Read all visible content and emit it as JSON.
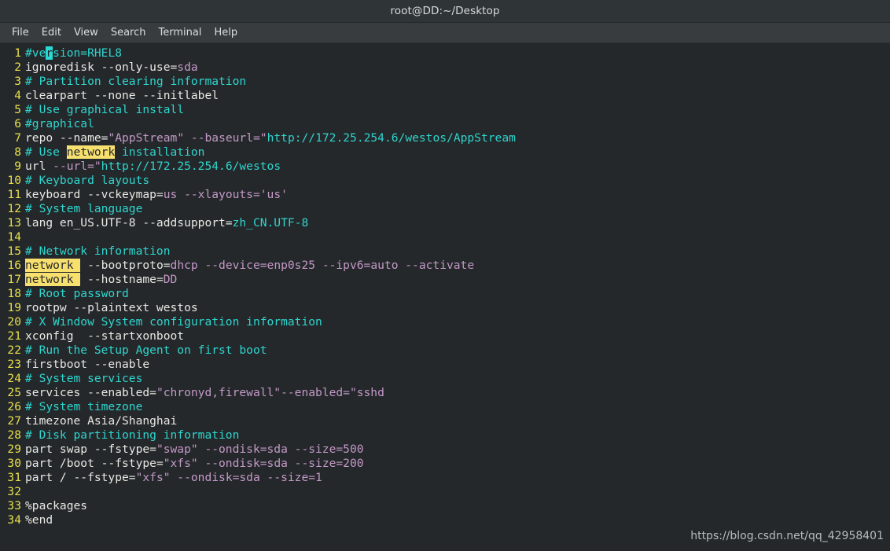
{
  "window": {
    "title": "root@DD:~/Desktop"
  },
  "menubar": {
    "items": [
      {
        "label": "File"
      },
      {
        "label": "Edit"
      },
      {
        "label": "View"
      },
      {
        "label": "Search"
      },
      {
        "label": "Terminal"
      },
      {
        "label": "Help"
      }
    ]
  },
  "editor": {
    "colors": {
      "background": "#24282b",
      "titlebar": "#2f3437",
      "menubar": "#383c3f",
      "foreground": "#e8e8e3",
      "lineno": "#e8e04a",
      "comment": "#2fd5cd",
      "string_mauve": "#c499c6",
      "string_cyan": "#2fd5cd",
      "cursor": "#29d9d5",
      "search_highlight": "#f7e06e"
    },
    "first_line": 1,
    "total_lines": 34,
    "lines": [
      {
        "n": "1",
        "tokens": [
          {
            "t": "#ve",
            "c": "comment"
          },
          {
            "t": "r",
            "c": "cursor"
          },
          {
            "t": "sion=RHEL8",
            "c": "comment"
          }
        ]
      },
      {
        "n": "2",
        "tokens": [
          {
            "t": "ignoredisk --only-use=",
            "c": "plain"
          },
          {
            "t": "sda",
            "c": "mauve"
          }
        ]
      },
      {
        "n": "3",
        "tokens": [
          {
            "t": "# Partition clearing information",
            "c": "comment"
          }
        ]
      },
      {
        "n": "4",
        "tokens": [
          {
            "t": "clearpart --none --initlabel",
            "c": "plain"
          }
        ]
      },
      {
        "n": "5",
        "tokens": [
          {
            "t": "# Use graphical install",
            "c": "comment"
          }
        ]
      },
      {
        "n": "6",
        "tokens": [
          {
            "t": "#graphical",
            "c": "comment"
          }
        ]
      },
      {
        "n": "7",
        "tokens": [
          {
            "t": "repo ",
            "c": "plain"
          },
          {
            "t": "--name=",
            "c": "plain"
          },
          {
            "t": "\"",
            "c": "mauve"
          },
          {
            "t": "AppStream",
            "c": "mauve"
          },
          {
            "t": "\"",
            "c": "mauve"
          },
          {
            "t": " ",
            "c": "plain"
          },
          {
            "t": "--baseurl=",
            "c": "mauve"
          },
          {
            "t": "\"",
            "c": "mauve"
          },
          {
            "t": "http://172.25.254.6/westos/AppStream",
            "c": "cyan"
          }
        ]
      },
      {
        "n": "8",
        "tokens": [
          {
            "t": "# Use ",
            "c": "comment"
          },
          {
            "t": "network",
            "c": "hl"
          },
          {
            "t": " installation",
            "c": "comment"
          }
        ]
      },
      {
        "n": "9",
        "tokens": [
          {
            "t": "url ",
            "c": "plain"
          },
          {
            "t": "--url=",
            "c": "mauve"
          },
          {
            "t": "\"",
            "c": "mauve"
          },
          {
            "t": "http://172.25.254.6/westos",
            "c": "cyan"
          }
        ]
      },
      {
        "n": "10",
        "tokens": [
          {
            "t": "# Keyboard layouts",
            "c": "comment"
          }
        ]
      },
      {
        "n": "11",
        "tokens": [
          {
            "t": "keyboard --vckeymap=",
            "c": "plain"
          },
          {
            "t": "us",
            "c": "mauve"
          },
          {
            "t": " --xlayouts='us'",
            "c": "mauve"
          }
        ]
      },
      {
        "n": "12",
        "tokens": [
          {
            "t": "# System language",
            "c": "comment"
          }
        ]
      },
      {
        "n": "13",
        "tokens": [
          {
            "t": "lang en_US.UTF-8 --addsupport=",
            "c": "plain"
          },
          {
            "t": "zh_CN.UTF-8",
            "c": "cyan"
          }
        ]
      },
      {
        "n": "14",
        "tokens": []
      },
      {
        "n": "15",
        "tokens": [
          {
            "t": "# Network information",
            "c": "comment"
          }
        ]
      },
      {
        "n": "16",
        "tokens": [
          {
            "t": "network ",
            "c": "hl"
          },
          {
            "t": " --bootproto=",
            "c": "plain"
          },
          {
            "t": "dhcp --device=enp0s25 --ipv6=auto --activate",
            "c": "mauve"
          }
        ]
      },
      {
        "n": "17",
        "tokens": [
          {
            "t": "network ",
            "c": "hl"
          },
          {
            "t": " --hostname=",
            "c": "plain"
          },
          {
            "t": "DD",
            "c": "mauve"
          }
        ]
      },
      {
        "n": "18",
        "tokens": [
          {
            "t": "# Root password",
            "c": "comment"
          }
        ]
      },
      {
        "n": "19",
        "tokens": [
          {
            "t": "rootpw --plaintext westos",
            "c": "plain"
          }
        ]
      },
      {
        "n": "20",
        "tokens": [
          {
            "t": "# X Window System configuration information",
            "c": "comment"
          }
        ]
      },
      {
        "n": "21",
        "tokens": [
          {
            "t": "xconfig  --startxonboot",
            "c": "plain"
          }
        ]
      },
      {
        "n": "22",
        "tokens": [
          {
            "t": "# Run the Setup Agent on first boot",
            "c": "comment"
          }
        ]
      },
      {
        "n": "23",
        "tokens": [
          {
            "t": "firstboot --enable",
            "c": "plain"
          }
        ]
      },
      {
        "n": "24",
        "tokens": [
          {
            "t": "# System services",
            "c": "comment"
          }
        ]
      },
      {
        "n": "25",
        "tokens": [
          {
            "t": "services --enabled=",
            "c": "plain"
          },
          {
            "t": "\"chronyd,firewall\"--enabled=\"sshd",
            "c": "mauve"
          }
        ]
      },
      {
        "n": "26",
        "tokens": [
          {
            "t": "# System timezone",
            "c": "comment"
          }
        ]
      },
      {
        "n": "27",
        "tokens": [
          {
            "t": "timezone Asia/Shanghai",
            "c": "plain"
          }
        ]
      },
      {
        "n": "28",
        "tokens": [
          {
            "t": "# Disk partitioning information",
            "c": "comment"
          }
        ]
      },
      {
        "n": "29",
        "tokens": [
          {
            "t": "part swap --fstype=",
            "c": "plain"
          },
          {
            "t": "\"swap\" --ondisk=sda --size=500",
            "c": "mauve"
          }
        ]
      },
      {
        "n": "30",
        "tokens": [
          {
            "t": "part /boot --fstype=",
            "c": "plain"
          },
          {
            "t": "\"xfs\" --ondisk=sda --size=200",
            "c": "mauve"
          }
        ]
      },
      {
        "n": "31",
        "tokens": [
          {
            "t": "part / --fstype=",
            "c": "plain"
          },
          {
            "t": "\"xfs\" --ondisk=sda --size=1",
            "c": "mauve"
          }
        ]
      },
      {
        "n": "32",
        "tokens": []
      },
      {
        "n": "33",
        "tokens": [
          {
            "t": "%packages",
            "c": "plain"
          }
        ]
      },
      {
        "n": "34",
        "tokens": [
          {
            "t": "%end",
            "c": "plain"
          }
        ]
      }
    ]
  },
  "watermark": {
    "text": "https://blog.csdn.net/qq_42958401"
  }
}
